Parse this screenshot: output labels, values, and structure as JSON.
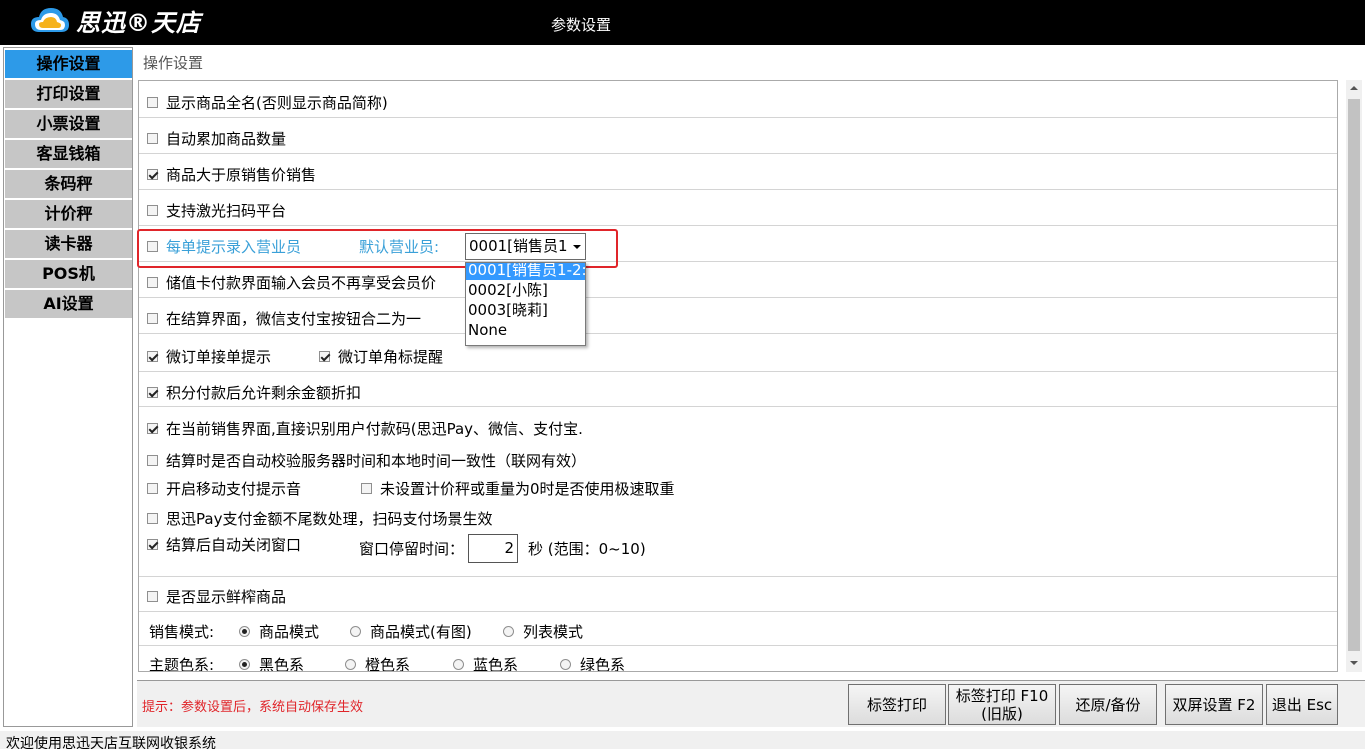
{
  "titlebar": {
    "logo_text": "思迅®天店",
    "title": "参数设置"
  },
  "sidebar": {
    "items": [
      {
        "label": "操作设置",
        "active": true
      },
      {
        "label": "打印设置"
      },
      {
        "label": "小票设置"
      },
      {
        "label": "客显钱箱"
      },
      {
        "label": "条码秤"
      },
      {
        "label": "计价秤"
      },
      {
        "label": "读卡器"
      },
      {
        "label": "POS机"
      },
      {
        "label": "AI设置"
      }
    ]
  },
  "section": {
    "title": "操作设置"
  },
  "options": {
    "full_name": {
      "label": "显示商品全名(否则显示商品简称)",
      "checked": false
    },
    "auto_accumulate": {
      "label": "自动累加商品数量",
      "checked": false
    },
    "above_price": {
      "label": "商品大于原销售价销售",
      "checked": true
    },
    "laser_scan": {
      "label": "支持激光扫码平台",
      "checked": false
    },
    "prompt_clerk": {
      "label": "每单提示录入营业员",
      "checked": false
    },
    "default_clerk_label": "默认营业员:",
    "default_clerk_value": "0001[销售员1",
    "stored_card": {
      "label": "储值卡付款界面输入会员不再享受会员价",
      "checked": false
    },
    "merge_wechat_alipay": {
      "label": "在结算界面，微信支付宝按钮合二为一",
      "checked": false
    },
    "wechat_order_prompt": {
      "label": "微订单接单提示",
      "checked": true
    },
    "wechat_order_badge": {
      "label": "微订单角标提醒",
      "checked": true
    },
    "points_discount": {
      "label": "积分付款后允许剩余金额折扣",
      "checked": true
    },
    "recognize_pay_code": {
      "label": "在当前销售界面,直接识别用户付款码(思迅Pay、微信、支付宝.",
      "checked": true
    },
    "verify_time": {
      "label": "结算时是否自动校验服务器时间和本地时间一致性（联网有效）",
      "checked": false
    },
    "mobile_pay_sound": {
      "label": "开启移动支付提示音",
      "checked": false
    },
    "fast_weigh": {
      "label": "未设置计价秤或重量为0时是否使用极速取重",
      "checked": false
    },
    "no_rounding": {
      "label": "思迅Pay支付金额不尾数处理，扫码支付场景生效",
      "checked": false
    },
    "auto_close": {
      "label": "结算后自动关闭窗口",
      "checked": true
    },
    "stay_time_label": "窗口停留时间：",
    "stay_time_value": "2",
    "stay_time_unit": "秒 (范围：0~10)",
    "fresh_juice": {
      "label": "是否显示鲜榨商品",
      "checked": false
    },
    "sales_mode": {
      "label": "销售模式:",
      "choices": [
        {
          "label": "商品模式",
          "checked": true
        },
        {
          "label": "商品模式(有图)",
          "checked": false
        },
        {
          "label": "列表模式",
          "checked": false
        }
      ]
    },
    "theme_color": {
      "label": "主题色系:",
      "choices": [
        {
          "label": "黑色系",
          "checked": true
        },
        {
          "label": "橙色系",
          "checked": false
        },
        {
          "label": "蓝色系",
          "checked": false
        },
        {
          "label": "绿色系",
          "checked": false
        }
      ]
    }
  },
  "dropdown": {
    "options": [
      "0001[销售员1-2:",
      "0002[小陈]",
      "0003[晓莉]",
      "None"
    ]
  },
  "bottom": {
    "hint": "提示：参数设置后，系统自动保存生效",
    "buttons": {
      "label_print": "标签打印",
      "label_print_old": "标签打印 F10\n(旧版)",
      "restore_backup": "还原/备份",
      "dual_screen": "双屏设置  F2",
      "exit": "退出 Esc"
    }
  },
  "statusbar": {
    "text": "欢迎使用思迅天店互联网收银系统"
  },
  "colors": {
    "accent": "#2d9ae8",
    "highlight_box": "#e0252a",
    "blue_text": "#3aa0d8"
  }
}
